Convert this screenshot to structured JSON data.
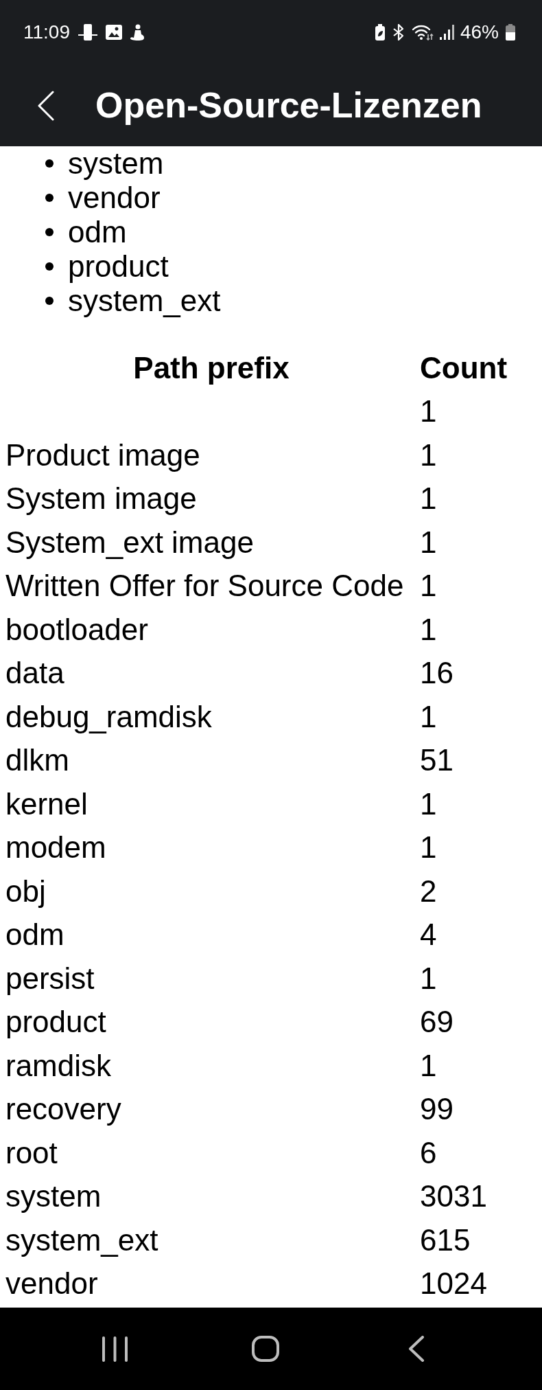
{
  "status_bar": {
    "time": "11:09",
    "battery_percent": "46%"
  },
  "app_bar": {
    "title": "Open-Source-Lizenzen"
  },
  "partitions": [
    "system",
    "vendor",
    "odm",
    "product",
    "system_ext"
  ],
  "table": {
    "columns": [
      "Path prefix",
      "Count"
    ],
    "rows": [
      {
        "count": "1"
      },
      {
        "path_prefix": "Product image",
        "count": "1"
      },
      {
        "path_prefix": "System image",
        "count": "1"
      },
      {
        "path_prefix": "System_ext image",
        "count": "1"
      },
      {
        "path_prefix": "Written Offer for Source Code",
        "count": "1"
      },
      {
        "path_prefix": "bootloader",
        "count": "1"
      },
      {
        "path_prefix": "data",
        "count": "16"
      },
      {
        "path_prefix": "debug_ramdisk",
        "count": "1"
      },
      {
        "path_prefix": "dlkm",
        "count": "51"
      },
      {
        "path_prefix": "kernel",
        "count": "1"
      },
      {
        "path_prefix": "modem",
        "count": "1"
      },
      {
        "path_prefix": "obj",
        "count": "2"
      },
      {
        "path_prefix": "odm",
        "count": "4"
      },
      {
        "path_prefix": "persist",
        "count": "1"
      },
      {
        "path_prefix": "product",
        "count": "69"
      },
      {
        "path_prefix": "ramdisk",
        "count": "1"
      },
      {
        "path_prefix": "recovery",
        "count": "99"
      },
      {
        "path_prefix": "root",
        "count": "6"
      },
      {
        "path_prefix": "system",
        "count": "3031"
      },
      {
        "path_prefix": "system_ext",
        "count": "615"
      },
      {
        "path_prefix": "vendor",
        "count": "1024"
      }
    ]
  }
}
